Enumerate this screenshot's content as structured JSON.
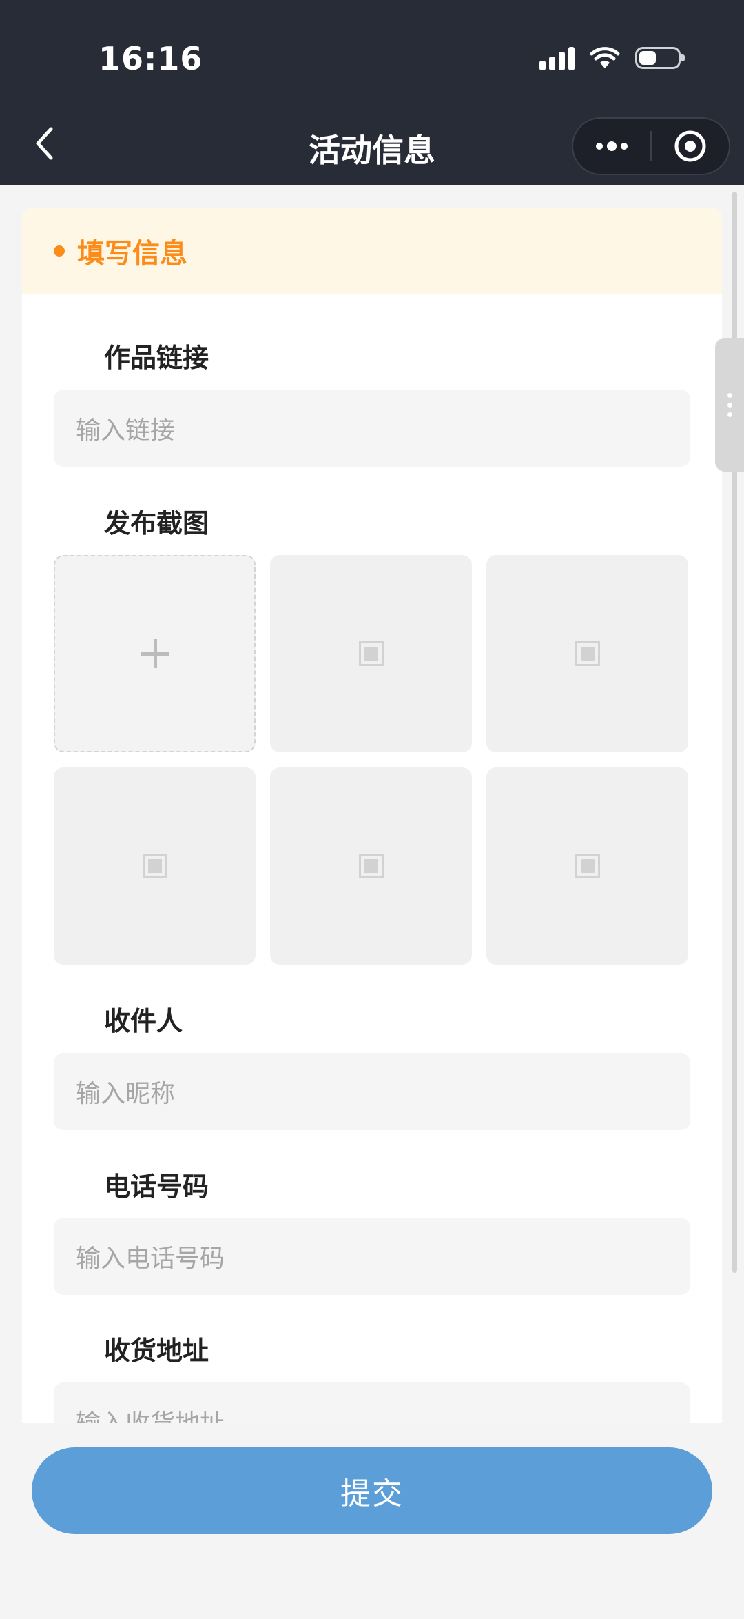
{
  "status_bar": {
    "time": "16:16",
    "battery_level": 0.45
  },
  "nav": {
    "title": "活动信息"
  },
  "section": {
    "title": "填写信息"
  },
  "fields": {
    "link": {
      "label": "作品链接",
      "placeholder": "输入链接"
    },
    "screenshot": {
      "label": "发布截图"
    },
    "recipient": {
      "label": "收件人",
      "placeholder": "输入昵称"
    },
    "phone": {
      "label": "电话号码",
      "placeholder": "输入电话号码"
    },
    "address": {
      "label": "收货地址",
      "placeholder": "输入收货地址"
    }
  },
  "submit": {
    "label": "提交"
  },
  "colors": {
    "accent": "#fb8c19",
    "button": "#5c9ed8",
    "header": "#282c37"
  }
}
